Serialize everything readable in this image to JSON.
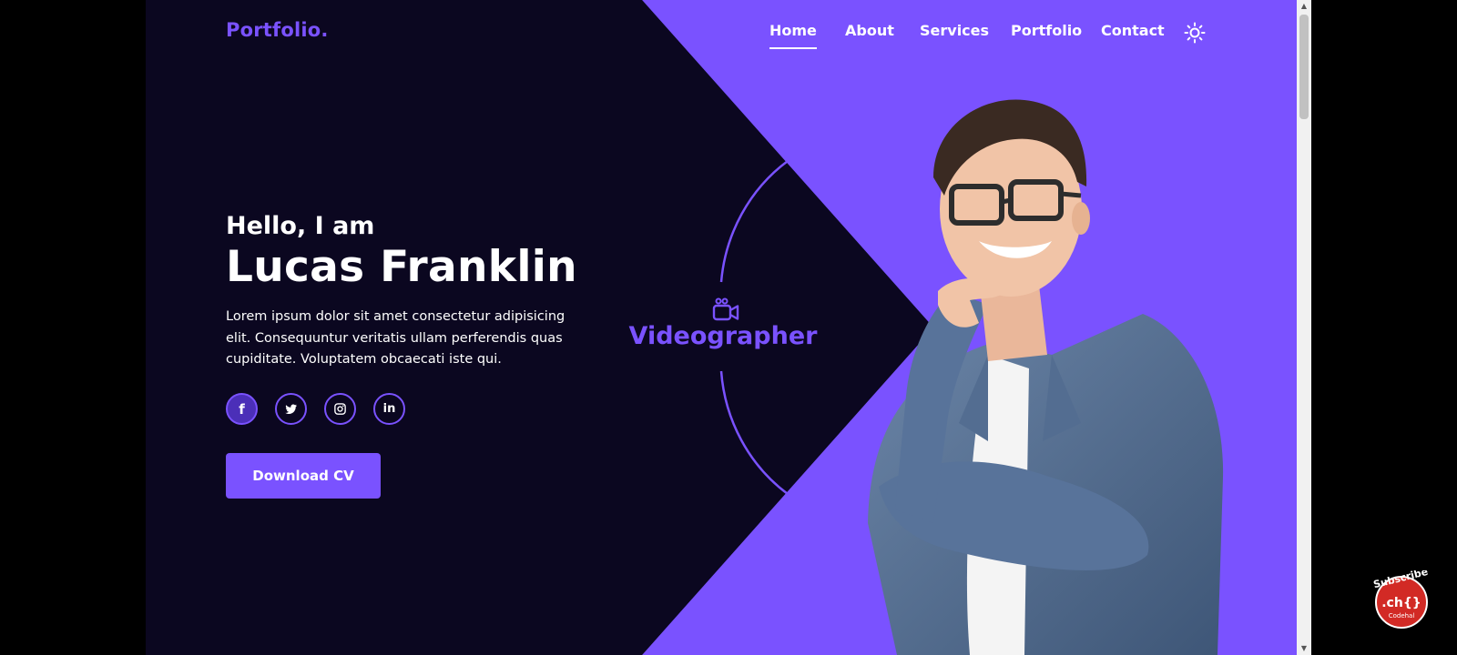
{
  "header": {
    "logo": "Portfolio.",
    "nav": [
      "Home",
      "About",
      "Services",
      "Portfolio",
      "Contact"
    ],
    "active_nav": "Home",
    "theme_toggle_icon": "sun-icon"
  },
  "hero": {
    "greeting": "Hello, I am",
    "name": "Lucas Franklin",
    "description": "Lorem ipsum dolor sit amet consectetur adipisicing elit. Consequuntur veritatis ullam perferendis quas cupiditate. Voluptatem obcaecati iste qui.",
    "socials": [
      {
        "icon": "facebook-icon",
        "glyph": "f"
      },
      {
        "icon": "twitter-icon",
        "glyph": ""
      },
      {
        "icon": "instagram-icon",
        "glyph": ""
      },
      {
        "icon": "linkedin-icon",
        "glyph": "in"
      }
    ],
    "cta": "Download CV",
    "role": "Videographer",
    "role_icon": "video-camera-icon"
  },
  "overlay": {
    "subscribe_text": "Subscribe",
    "channel_mark": ".ch{}",
    "channel_name": "Codehal"
  },
  "colors": {
    "background": "#0b0720",
    "accent": "#7a52ff",
    "text": "#ffffff"
  }
}
